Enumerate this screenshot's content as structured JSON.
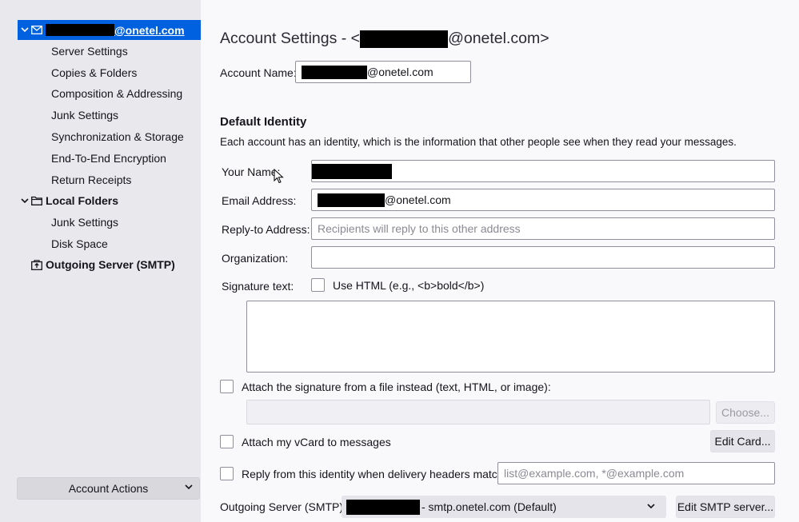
{
  "sidebar": {
    "account": {
      "label_suffix": "@onetel.com"
    },
    "items": [
      {
        "label": "Server Settings"
      },
      {
        "label": "Copies & Folders"
      },
      {
        "label": "Composition & Addressing"
      },
      {
        "label": "Junk Settings"
      },
      {
        "label": "Synchronization & Storage"
      },
      {
        "label": "End-To-End Encryption"
      },
      {
        "label": "Return Receipts"
      }
    ],
    "local_folders": {
      "label": "Local Folders",
      "items": [
        {
          "label": "Junk Settings"
        },
        {
          "label": "Disk Space"
        }
      ]
    },
    "outgoing": {
      "label": "Outgoing Server (SMTP)"
    },
    "account_actions": {
      "label": "Account Actions"
    }
  },
  "main": {
    "title_prefix": "Account Settings - <",
    "title_suffix": "@onetel.com>",
    "account_name": {
      "label": "Account Name:",
      "value_suffix": "@onetel.com"
    },
    "default_identity": {
      "heading": "Default Identity",
      "description": "Each account has an identity, which is the information that other people see when they read your messages."
    },
    "your_name": {
      "label": "Your Name:"
    },
    "email": {
      "label": "Email Address:",
      "value_suffix": "@onetel.com"
    },
    "reply_to": {
      "label": "Reply-to Address:",
      "placeholder": "Recipients will reply to this other address"
    },
    "organization": {
      "label": "Organization:"
    },
    "signature": {
      "label": "Signature text:",
      "use_html": "Use HTML (e.g., <b>bold</b>)"
    },
    "attach_signature": {
      "label": "Attach the signature from a file instead (text, HTML, or image):",
      "choose": "Choose..."
    },
    "vcard": {
      "label": "Attach my vCard to messages",
      "edit": "Edit Card..."
    },
    "reply_identity": {
      "label": "Reply from this identity when delivery headers match:",
      "placeholder": "list@example.com, *@example.com"
    },
    "smtp": {
      "label": "Outgoing Server (SMTP):",
      "value_suffix": "- smtp.onetel.com (Default)",
      "edit": "Edit SMTP server..."
    }
  },
  "colors": {
    "selection": "#0061e0",
    "sidebar_bg": "#e8e8ed",
    "main_bg": "#f9f9fb"
  }
}
